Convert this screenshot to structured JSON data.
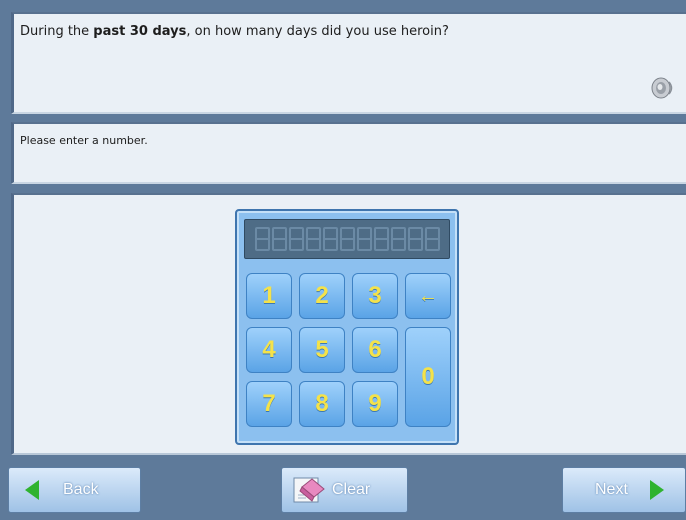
{
  "question": {
    "prefix": "During the ",
    "bold": "past 30 days",
    "suffix": ", on how many days did you use heroin?"
  },
  "instruction": "Please enter a number.",
  "keypad": {
    "display_value": "",
    "keys": {
      "k1": "1",
      "k2": "2",
      "k3": "3",
      "backspace": "←",
      "k4": "4",
      "k5": "5",
      "k6": "6",
      "k0": "0",
      "k7": "7",
      "k8": "8",
      "k9": "9"
    }
  },
  "nav": {
    "back_label": "Back",
    "clear_label": "Clear",
    "next_label": "Next"
  },
  "icons": {
    "speaker": "speaker-icon",
    "back": "arrow-left-icon",
    "clear": "eraser-icon",
    "next": "arrow-right-icon"
  },
  "colors": {
    "background": "#5e7a9a",
    "panel": "#eaf0f6",
    "keypad": "#8cc0ef",
    "key_text": "#f4e24a",
    "arrow": "#2fb32f"
  }
}
